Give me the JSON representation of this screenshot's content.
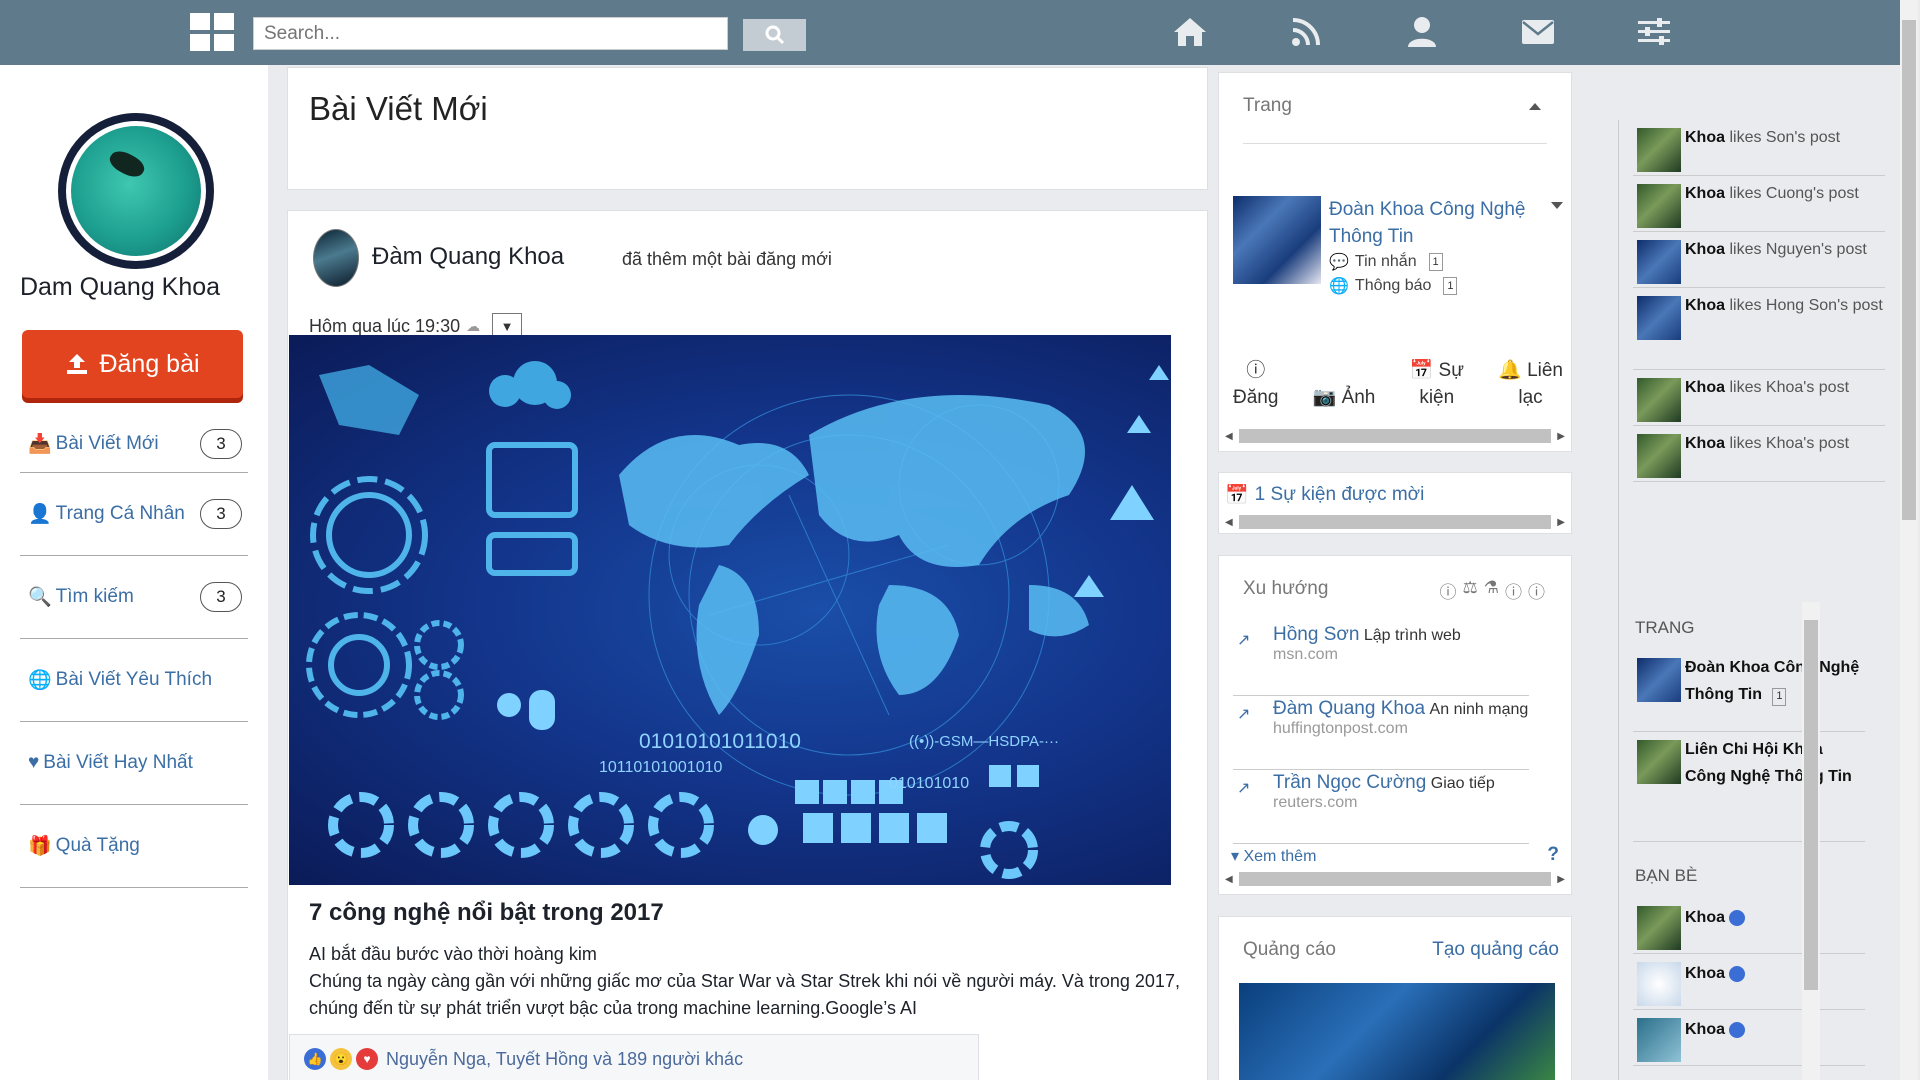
{
  "topbar": {
    "search_placeholder": "Search...",
    "nav": [
      "home-icon",
      "rss-icon",
      "user-icon",
      "mail-icon",
      "settings-sliders-icon"
    ]
  },
  "sidebar": {
    "profile_name": "Dam Quang Khoa",
    "post_button": "Đăng bài",
    "items": [
      {
        "label": "Bài Viết Mới",
        "icon": "inbox-icon",
        "count": "3"
      },
      {
        "label": "Trang Cá Nhân",
        "icon": "user-circle-icon",
        "count": "3"
      },
      {
        "label": "Tìm kiếm",
        "icon": "search-icon",
        "count": "3"
      },
      {
        "label": "Bài Viết Yêu Thích",
        "icon": "globe-icon",
        "count": ""
      },
      {
        "label": "Bài Viết Hay Nhất",
        "icon": "heart-icon",
        "count": ""
      },
      {
        "label": "Quà Tặng",
        "icon": "gift-icon",
        "count": ""
      }
    ]
  },
  "feed": {
    "title": "Bài Viết Mới",
    "post": {
      "author": "Đàm Quang Khoa",
      "action": "đã thêm một bài đăng mới",
      "time": "Hôm qua lúc 19:30",
      "title": "7 công nghệ nổi bật trong 2017",
      "line1": "AI bắt đầu bước vào thời hoàng kim",
      "line2": "Chúng ta ngày càng gần với những giấc mơ của Star War và Star Strek khi nói về người máy. Và trong 2017, chúng đến từ sự phát triển vượt bậc của trong machine learning.Google’s AI",
      "reactions_text": "Nguyễn Nga, Tuyết Hồng và 189 người khác",
      "image_text": {
        "bin1": "01010101011010",
        "bin2": "10110101001010",
        "bin3": "010101010",
        "gsm": "((•))-GSM—HSDPA-···"
      }
    }
  },
  "pages": {
    "title": "Trang",
    "page_name": "Đoàn Khoa Công Nghệ Thông Tin",
    "messages_label": "Tin nhắn",
    "messages_count": "1",
    "notifications_label": "Thông báo",
    "notifications_count": "1",
    "actions": [
      {
        "icon": "info-icon",
        "l1": "",
        "l2": "Đăng"
      },
      {
        "icon": "camera-icon",
        "l1": "",
        "l2": "Ảnh"
      },
      {
        "icon": "calendar-icon",
        "l1": "Sự",
        "l2": "kiện"
      },
      {
        "icon": "bell-icon",
        "l1": "Liên",
        "l2": "lạc"
      }
    ]
  },
  "events": {
    "text": "1 Sự kiện được mời"
  },
  "trending": {
    "title": "Xu hướng",
    "items": [
      {
        "name": "Hồng Sơn",
        "topic": "Lập trình web",
        "source": "msn.com"
      },
      {
        "name": "Đàm Quang Khoa",
        "topic": "An ninh mạng",
        "source": "huffingtonpost.com"
      },
      {
        "name": "Trần Ngọc Cường",
        "topic": "Giao tiếp",
        "source": "reuters.com"
      }
    ],
    "see_more": "Xem thêm",
    "help": "?"
  },
  "ads": {
    "title": "Quảng cáo",
    "create": "Tạo quảng cáo"
  },
  "ticker": {
    "items": [
      {
        "who": "Khoa",
        "text": "likes Son's post"
      },
      {
        "who": "Khoa",
        "text": "likes Cuong's post"
      },
      {
        "who": "Khoa",
        "text": "likes Nguyen's post"
      },
      {
        "who": "Khoa",
        "text": "likes Hong Son's post"
      },
      {
        "who": "Khoa",
        "text": "likes Khoa's post"
      },
      {
        "who": "Khoa",
        "text": "likes Khoa's post"
      }
    ],
    "pages_title": "TRANG",
    "pages": [
      {
        "name": "Đoàn Khoa Công Nghệ Thông Tin",
        "count": "1"
      },
      {
        "name": "Liên Chi Hội Khoa Công Nghệ Thông Tin",
        "count": ""
      }
    ],
    "friends_title": "BẠN BÈ",
    "friends": [
      "Khoa",
      "Khoa",
      "Khoa"
    ]
  }
}
